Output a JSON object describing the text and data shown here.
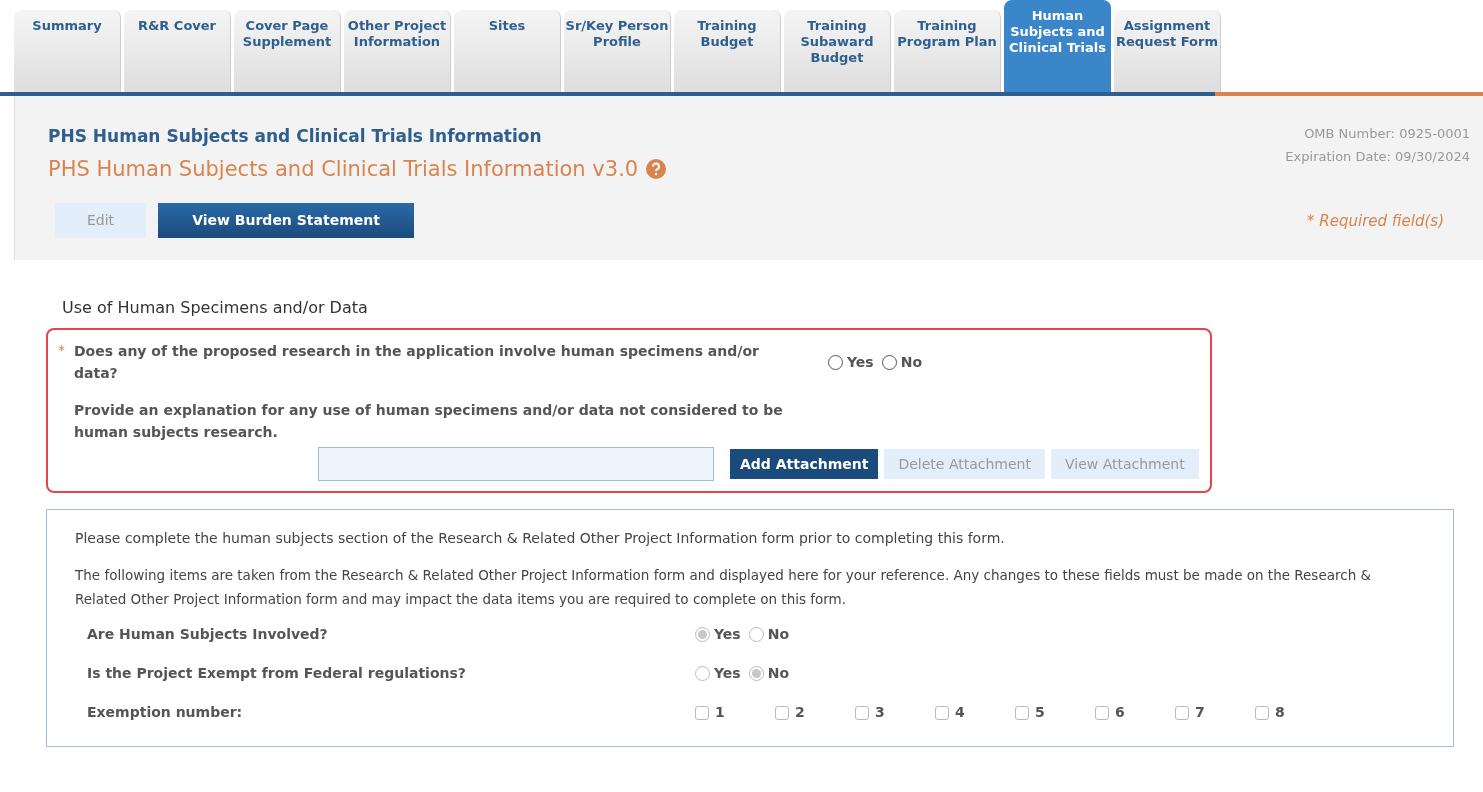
{
  "tabs": [
    {
      "label": "Summary",
      "selected": false
    },
    {
      "label": "R&R Cover",
      "selected": false
    },
    {
      "label": "Cover Page Supplement",
      "selected": false
    },
    {
      "label": "Other Project Information",
      "selected": false
    },
    {
      "label": "Sites",
      "selected": false
    },
    {
      "label": "Sr/Key Person Profile",
      "selected": false
    },
    {
      "label": "Training Budget",
      "selected": false
    },
    {
      "label": "Training Subaward Budget",
      "selected": false
    },
    {
      "label": "Training Program Plan",
      "selected": false
    },
    {
      "label": "Human Subjects and Clinical Trials",
      "selected": true
    },
    {
      "label": "Assignment Request Form",
      "selected": false
    }
  ],
  "header": {
    "title": "PHS Human Subjects and Clinical Trials Information",
    "subtitle": "PHS Human Subjects and Clinical Trials Information v3.0",
    "omb_number": "OMB Number: 0925-0001",
    "expiration_date": "Expiration Date: 09/30/2024",
    "required_note": "* Required field(s)",
    "buttons": [
      {
        "label": "Edit",
        "disabled": true
      },
      {
        "label": "View Burden Statement",
        "disabled": false
      }
    ]
  },
  "section": {
    "title": "Use of Human Specimens and/or Data",
    "question": {
      "required_mark": "*",
      "text": "Does any of the proposed research in the application involve human specimens and/or data?",
      "options": [
        {
          "label": "Yes",
          "selected": false
        },
        {
          "label": "No",
          "selected": false
        }
      ]
    },
    "explanation": "Provide an explanation for any use of human specimens and/or data not considered to be human subjects research.",
    "attachment_buttons": [
      {
        "label": "Add Attachment",
        "disabled": false
      },
      {
        "label": "Delete Attachment",
        "disabled": true
      },
      {
        "label": "View Attachment",
        "disabled": true
      }
    ]
  },
  "reference": {
    "note": "Please complete the human subjects section of the Research & Related Other Project Information form prior to completing this form.",
    "intro": "The following items are taken from the Research & Related Other Project Information form and displayed here for your reference. Any changes to these fields must be made on the Research & Related Other Project Information form and may impact the data items you are required to complete on this form.",
    "rows": [
      {
        "kind": "radio",
        "label": "Are Human Subjects Involved?",
        "options": [
          {
            "label": "Yes",
            "selected": true
          },
          {
            "label": "No",
            "selected": false
          }
        ]
      },
      {
        "kind": "radio",
        "label": "Is the Project Exempt from Federal regulations?",
        "options": [
          {
            "label": "Yes",
            "selected": false
          },
          {
            "label": "No",
            "selected": true
          }
        ]
      },
      {
        "kind": "checkbox",
        "label": "Exemption number:",
        "options": [
          {
            "label": "1",
            "checked": false
          },
          {
            "label": "2",
            "checked": false
          },
          {
            "label": "3",
            "checked": false
          },
          {
            "label": "4",
            "checked": false
          },
          {
            "label": "5",
            "checked": false
          },
          {
            "label": "6",
            "checked": false
          },
          {
            "label": "7",
            "checked": false
          },
          {
            "label": "8",
            "checked": false
          }
        ]
      }
    ]
  }
}
